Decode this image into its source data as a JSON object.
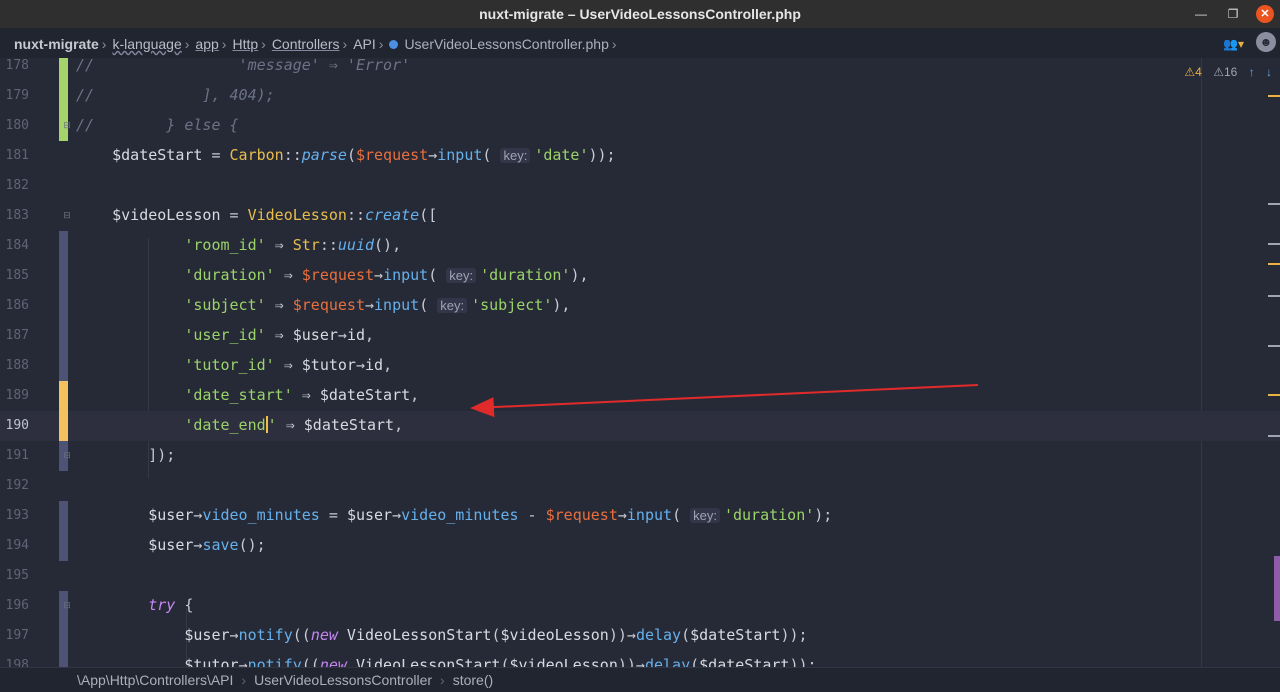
{
  "window": {
    "title": "nuxt-migrate – UserVideoLessonsController.php",
    "controls": [
      "—",
      "❐",
      "✕"
    ]
  },
  "breadcrumb": [
    {
      "label": "nuxt-migrate",
      "style": "root"
    },
    {
      "label": "k-language",
      "style": "wavy"
    },
    {
      "label": "app",
      "style": "ul"
    },
    {
      "label": "Http",
      "style": "ul"
    },
    {
      "label": "Controllers",
      "style": "ul"
    },
    {
      "label": "API",
      "style": "plain"
    },
    {
      "label": "UserVideoLessonsController.php",
      "style": "file"
    }
  ],
  "inspection": {
    "warnings": "4",
    "weak_warnings": "16"
  },
  "code_lines": [
    {
      "num": "178",
      "gutter": "green",
      "tokens": [
        [
          "com",
          "//                'message' ⇒ 'Error'"
        ]
      ]
    },
    {
      "num": "179",
      "gutter": "green",
      "tokens": [
        [
          "com",
          "//            ], 404);"
        ]
      ]
    },
    {
      "num": "180",
      "gutter": "green",
      "fold": true,
      "tokens": [
        [
          "com",
          "//        } else {"
        ]
      ]
    },
    {
      "num": "181",
      "gutter": "",
      "tokens": [
        [
          "var",
          "    $dateStart "
        ],
        [
          "op",
          "= "
        ],
        [
          "cls",
          "Carbon"
        ],
        [
          "op",
          "::"
        ],
        [
          "fni",
          "parse"
        ],
        [
          "op",
          "("
        ],
        [
          "req",
          "$request"
        ],
        [
          "op",
          "→"
        ],
        [
          "fn",
          "input"
        ],
        [
          "op",
          "( "
        ],
        [
          "hint",
          "key:"
        ],
        [
          "str",
          "'date'"
        ],
        [
          "op",
          "));"
        ]
      ]
    },
    {
      "num": "182",
      "gutter": "",
      "tokens": []
    },
    {
      "num": "183",
      "gutter": "",
      "fold": true,
      "tokens": [
        [
          "var",
          "    $videoLesson "
        ],
        [
          "op",
          "= "
        ],
        [
          "cls",
          "VideoLesson"
        ],
        [
          "op",
          "::"
        ],
        [
          "fni",
          "create"
        ],
        [
          "op",
          "(["
        ]
      ]
    },
    {
      "num": "184",
      "gutter": "purple",
      "tokens": [
        [
          "str",
          "            'room_id'"
        ],
        [
          "op",
          " ⇒ "
        ],
        [
          "cls",
          "Str"
        ],
        [
          "op",
          "::"
        ],
        [
          "fni",
          "uuid"
        ],
        [
          "op",
          "(),"
        ]
      ]
    },
    {
      "num": "185",
      "gutter": "purple",
      "tokens": [
        [
          "str",
          "            'duration'"
        ],
        [
          "op",
          " ⇒ "
        ],
        [
          "req",
          "$request"
        ],
        [
          "op",
          "→"
        ],
        [
          "fn",
          "input"
        ],
        [
          "op",
          "( "
        ],
        [
          "hint",
          "key:"
        ],
        [
          "str",
          "'duration'"
        ],
        [
          "op",
          "),"
        ]
      ]
    },
    {
      "num": "186",
      "gutter": "purple",
      "tokens": [
        [
          "str",
          "            'subject'"
        ],
        [
          "op",
          " ⇒ "
        ],
        [
          "req",
          "$request"
        ],
        [
          "op",
          "→"
        ],
        [
          "fn",
          "input"
        ],
        [
          "op",
          "( "
        ],
        [
          "hint",
          "key:"
        ],
        [
          "str",
          "'subject'"
        ],
        [
          "op",
          "),"
        ]
      ]
    },
    {
      "num": "187",
      "gutter": "purple",
      "tokens": [
        [
          "str",
          "            'user_id'"
        ],
        [
          "op",
          " ⇒ "
        ],
        [
          "var",
          "$user"
        ],
        [
          "op",
          "→"
        ],
        [
          "var",
          "id"
        ],
        [
          "op",
          ","
        ]
      ]
    },
    {
      "num": "188",
      "gutter": "purple",
      "tokens": [
        [
          "str",
          "            'tutor_id'"
        ],
        [
          "op",
          " ⇒ "
        ],
        [
          "var",
          "$tutor"
        ],
        [
          "op",
          "→"
        ],
        [
          "var",
          "id"
        ],
        [
          "op",
          ","
        ]
      ]
    },
    {
      "num": "189",
      "gutter": "yellow",
      "tokens": [
        [
          "str",
          "            'date_start'"
        ],
        [
          "op",
          " ⇒ "
        ],
        [
          "var",
          "$dateStart"
        ],
        [
          "op",
          ","
        ]
      ]
    },
    {
      "num": "190",
      "gutter": "yellow",
      "current": true,
      "tokens": [
        [
          "str",
          "            'date_end"
        ],
        [
          "caret",
          ""
        ],
        [
          "str",
          "'"
        ],
        [
          "op",
          " ⇒ "
        ],
        [
          "var",
          "$dateStart"
        ],
        [
          "op",
          ","
        ]
      ]
    },
    {
      "num": "191",
      "gutter": "purple",
      "fold": true,
      "tokens": [
        [
          "op",
          "        ]);"
        ]
      ]
    },
    {
      "num": "192",
      "gutter": "",
      "tokens": []
    },
    {
      "num": "193",
      "gutter": "purple",
      "tokens": [
        [
          "var",
          "        $user"
        ],
        [
          "op",
          "→"
        ],
        [
          "fn",
          "video_minutes"
        ],
        [
          "op",
          " = "
        ],
        [
          "var",
          "$user"
        ],
        [
          "op",
          "→"
        ],
        [
          "fn",
          "video_minutes"
        ],
        [
          "op",
          " - "
        ],
        [
          "req",
          "$request"
        ],
        [
          "op",
          "→"
        ],
        [
          "fn",
          "input"
        ],
        [
          "op",
          "( "
        ],
        [
          "hint",
          "key:"
        ],
        [
          "str",
          "'duration'"
        ],
        [
          "op",
          ");"
        ]
      ]
    },
    {
      "num": "194",
      "gutter": "purple",
      "tokens": [
        [
          "var",
          "        $user"
        ],
        [
          "op",
          "→"
        ],
        [
          "fn",
          "save"
        ],
        [
          "op",
          "();"
        ]
      ]
    },
    {
      "num": "195",
      "gutter": "",
      "tokens": []
    },
    {
      "num": "196",
      "gutter": "purple",
      "fold": true,
      "tokens": [
        [
          "kw",
          "        try"
        ],
        [
          "op",
          " {"
        ]
      ]
    },
    {
      "num": "197",
      "gutter": "purple",
      "tokens": [
        [
          "var",
          "            $user"
        ],
        [
          "op",
          "→"
        ],
        [
          "fn",
          "notify"
        ],
        [
          "op",
          "(("
        ],
        [
          "kw",
          "new"
        ],
        [
          "var",
          " VideoLessonStart"
        ],
        [
          "op",
          "("
        ],
        [
          "var",
          "$videoLesson"
        ],
        [
          "op",
          "))→"
        ],
        [
          "fn",
          "delay"
        ],
        [
          "op",
          "("
        ],
        [
          "var",
          "$dateStart"
        ],
        [
          "op",
          "));"
        ]
      ]
    },
    {
      "num": "198",
      "gutter": "purple",
      "tokens": [
        [
          "var",
          "            $tutor"
        ],
        [
          "op",
          "→"
        ],
        [
          "fn",
          "notify"
        ],
        [
          "op",
          "(("
        ],
        [
          "kw",
          "new"
        ],
        [
          "var",
          " VideoLessonStart"
        ],
        [
          "op",
          "("
        ],
        [
          "var",
          "$videoLesson"
        ],
        [
          "op",
          "))→"
        ],
        [
          "fn",
          "delay"
        ],
        [
          "op",
          "("
        ],
        [
          "var",
          "$dateStart"
        ],
        [
          "op",
          "));"
        ]
      ]
    }
  ],
  "statusbar": [
    "\\App\\Http\\Controllers\\API",
    "UserVideoLessonsController",
    "store()"
  ],
  "colors": {
    "gutter_green": "#a5d46b",
    "gutter_yellow": "#f3c25e",
    "gutter_purple": "#4e5275",
    "annotation_arrow": "#e12a2a"
  },
  "icons": {
    "users": "users-icon",
    "avatar": "avatar",
    "warning": "warning-icon",
    "arrows": [
      "arrow-up-icon",
      "arrow-down-icon"
    ]
  }
}
